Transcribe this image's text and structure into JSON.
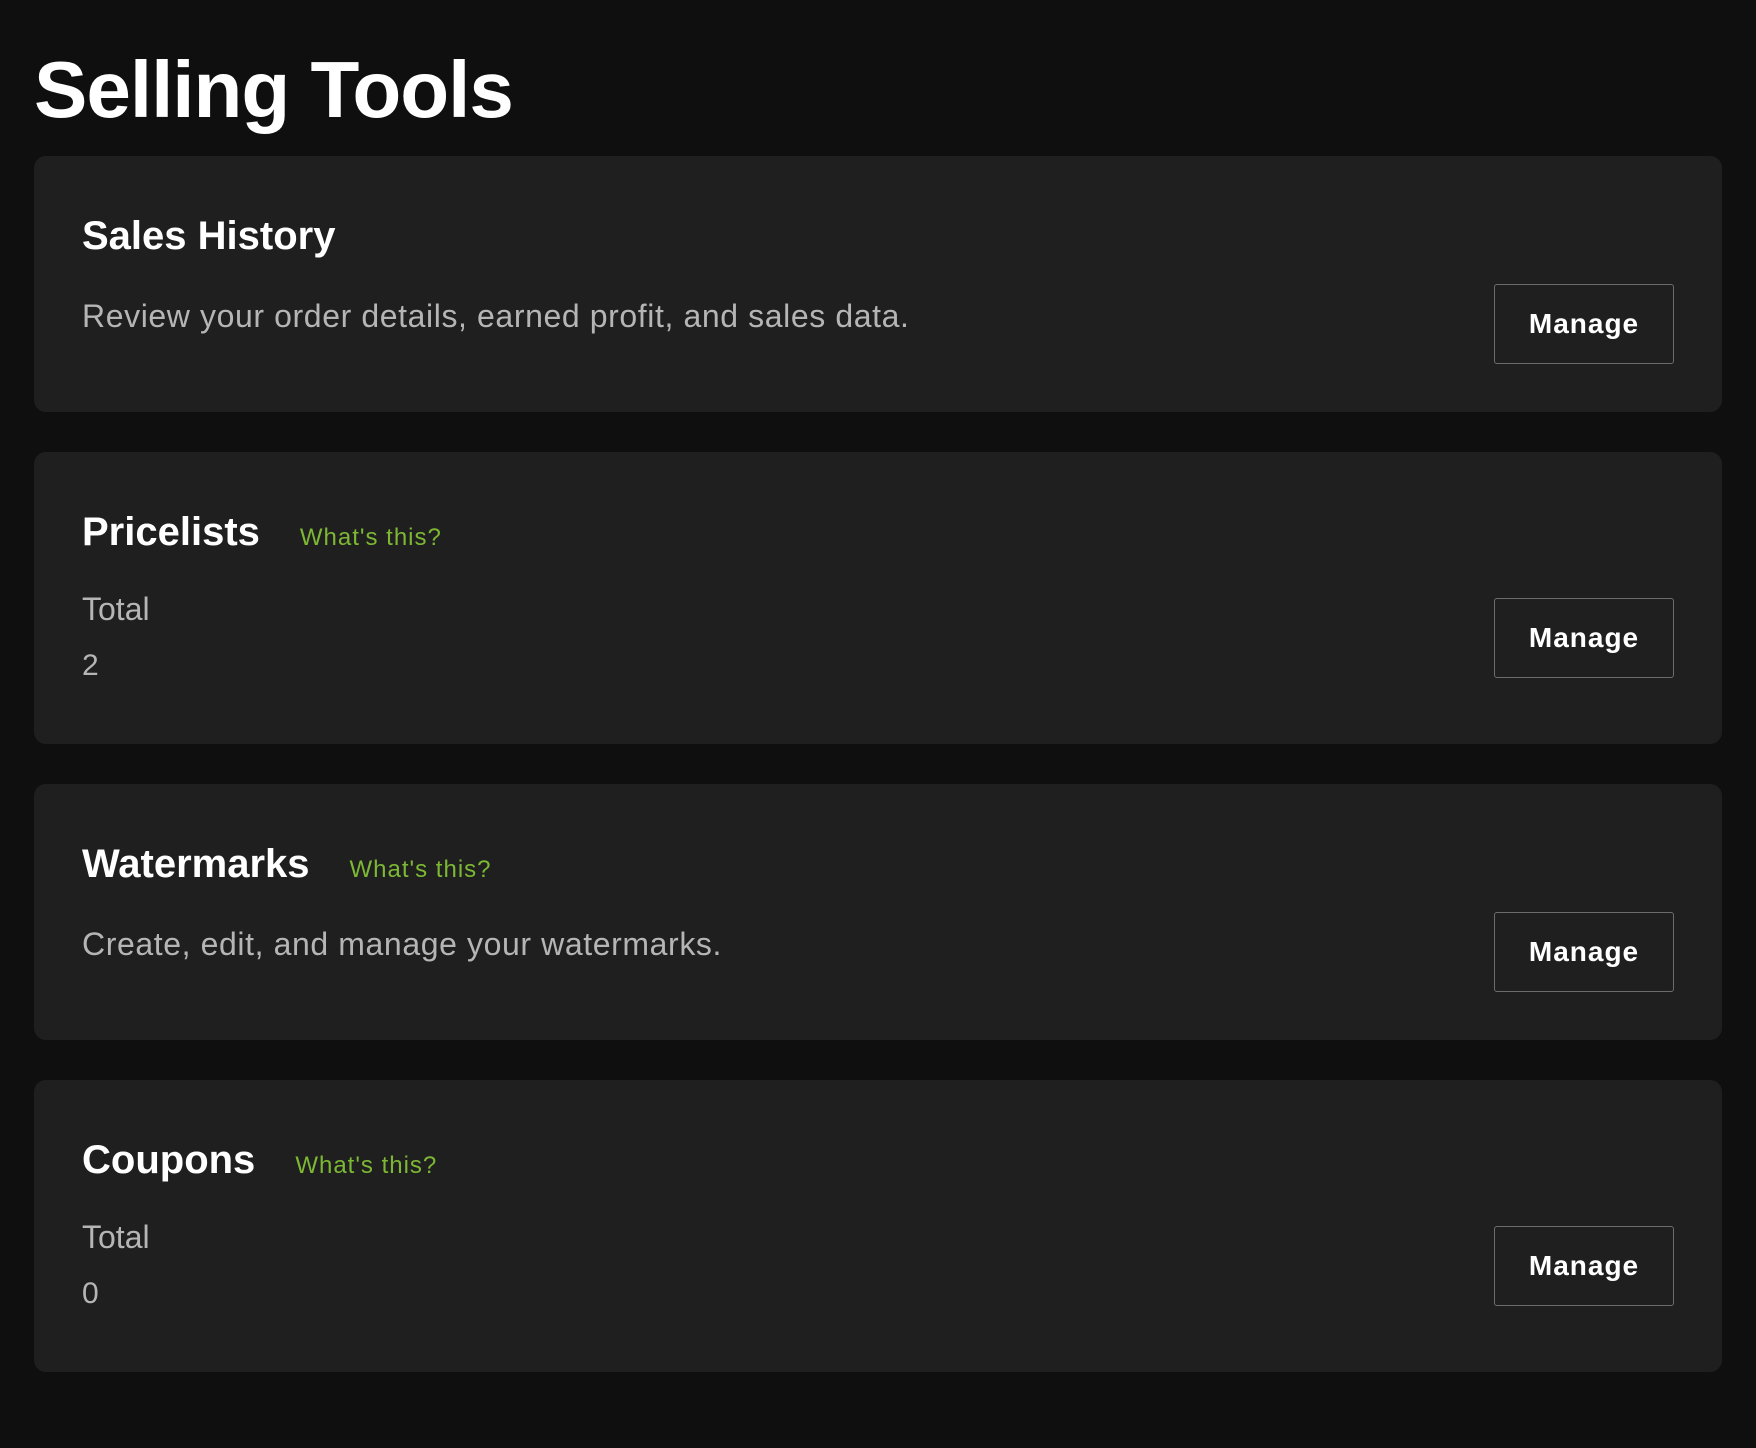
{
  "page": {
    "title": "Selling Tools"
  },
  "colors": {
    "background": "#0f0f0f",
    "card": "#1f1f1f",
    "accent_link": "#7db834",
    "muted_text": "#b5b5b5"
  },
  "cards": {
    "sales_history": {
      "title": "Sales History",
      "description": "Review your order details, earned profit, and sales data.",
      "button_label": "Manage"
    },
    "pricelists": {
      "title": "Pricelists",
      "help_link": "What's this?",
      "stat_label": "Total",
      "stat_value": "2",
      "button_label": "Manage"
    },
    "watermarks": {
      "title": "Watermarks",
      "help_link": "What's this?",
      "description": "Create, edit, and manage your watermarks.",
      "button_label": "Manage"
    },
    "coupons": {
      "title": "Coupons",
      "help_link": "What's this?",
      "stat_label": "Total",
      "stat_value": "0",
      "button_label": "Manage"
    }
  }
}
